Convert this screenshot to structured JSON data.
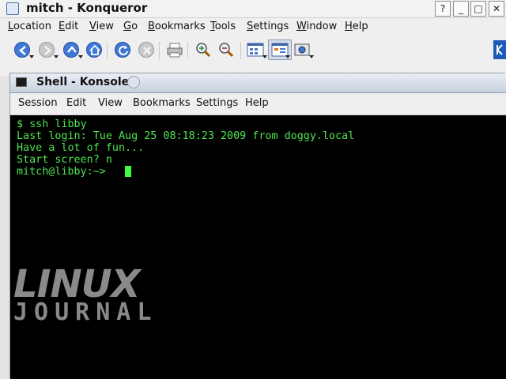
{
  "konqueror": {
    "window_title": "mitch - Konqueror",
    "window_buttons": [
      "?",
      "_",
      "□",
      "✕"
    ],
    "menu": [
      "Location",
      "Edit",
      "View",
      "Go",
      "Bookmarks",
      "Tools",
      "Settings",
      "Window",
      "Help"
    ],
    "toolbar_icons": [
      "back-icon",
      "forward-icon",
      "up-icon",
      "home-icon",
      "reload-icon",
      "stop-icon",
      "print-icon",
      "zoom-in-icon",
      "zoom-out-icon",
      "icon-view-icon",
      "detail-view-icon",
      "screenshot-icon",
      "kde-icon"
    ]
  },
  "konsole": {
    "window_title": "Shell - Konsole",
    "menu": [
      "Session",
      "Edit",
      "View",
      "Bookmarks",
      "Settings",
      "Help"
    ],
    "terminal": {
      "lines": [
        "$ ssh libby",
        "Last login: Tue Aug 25 08:18:23 2009 from doggy.local",
        "Have a lot of fun...",
        "Start screen? n",
        "mitch@libby:~>"
      ],
      "text_color": "#4ee34e",
      "background": "#000000"
    }
  },
  "watermark": {
    "line1": "LINUX",
    "line2": "JOURNAL",
    "color": "#8a8a8a"
  }
}
